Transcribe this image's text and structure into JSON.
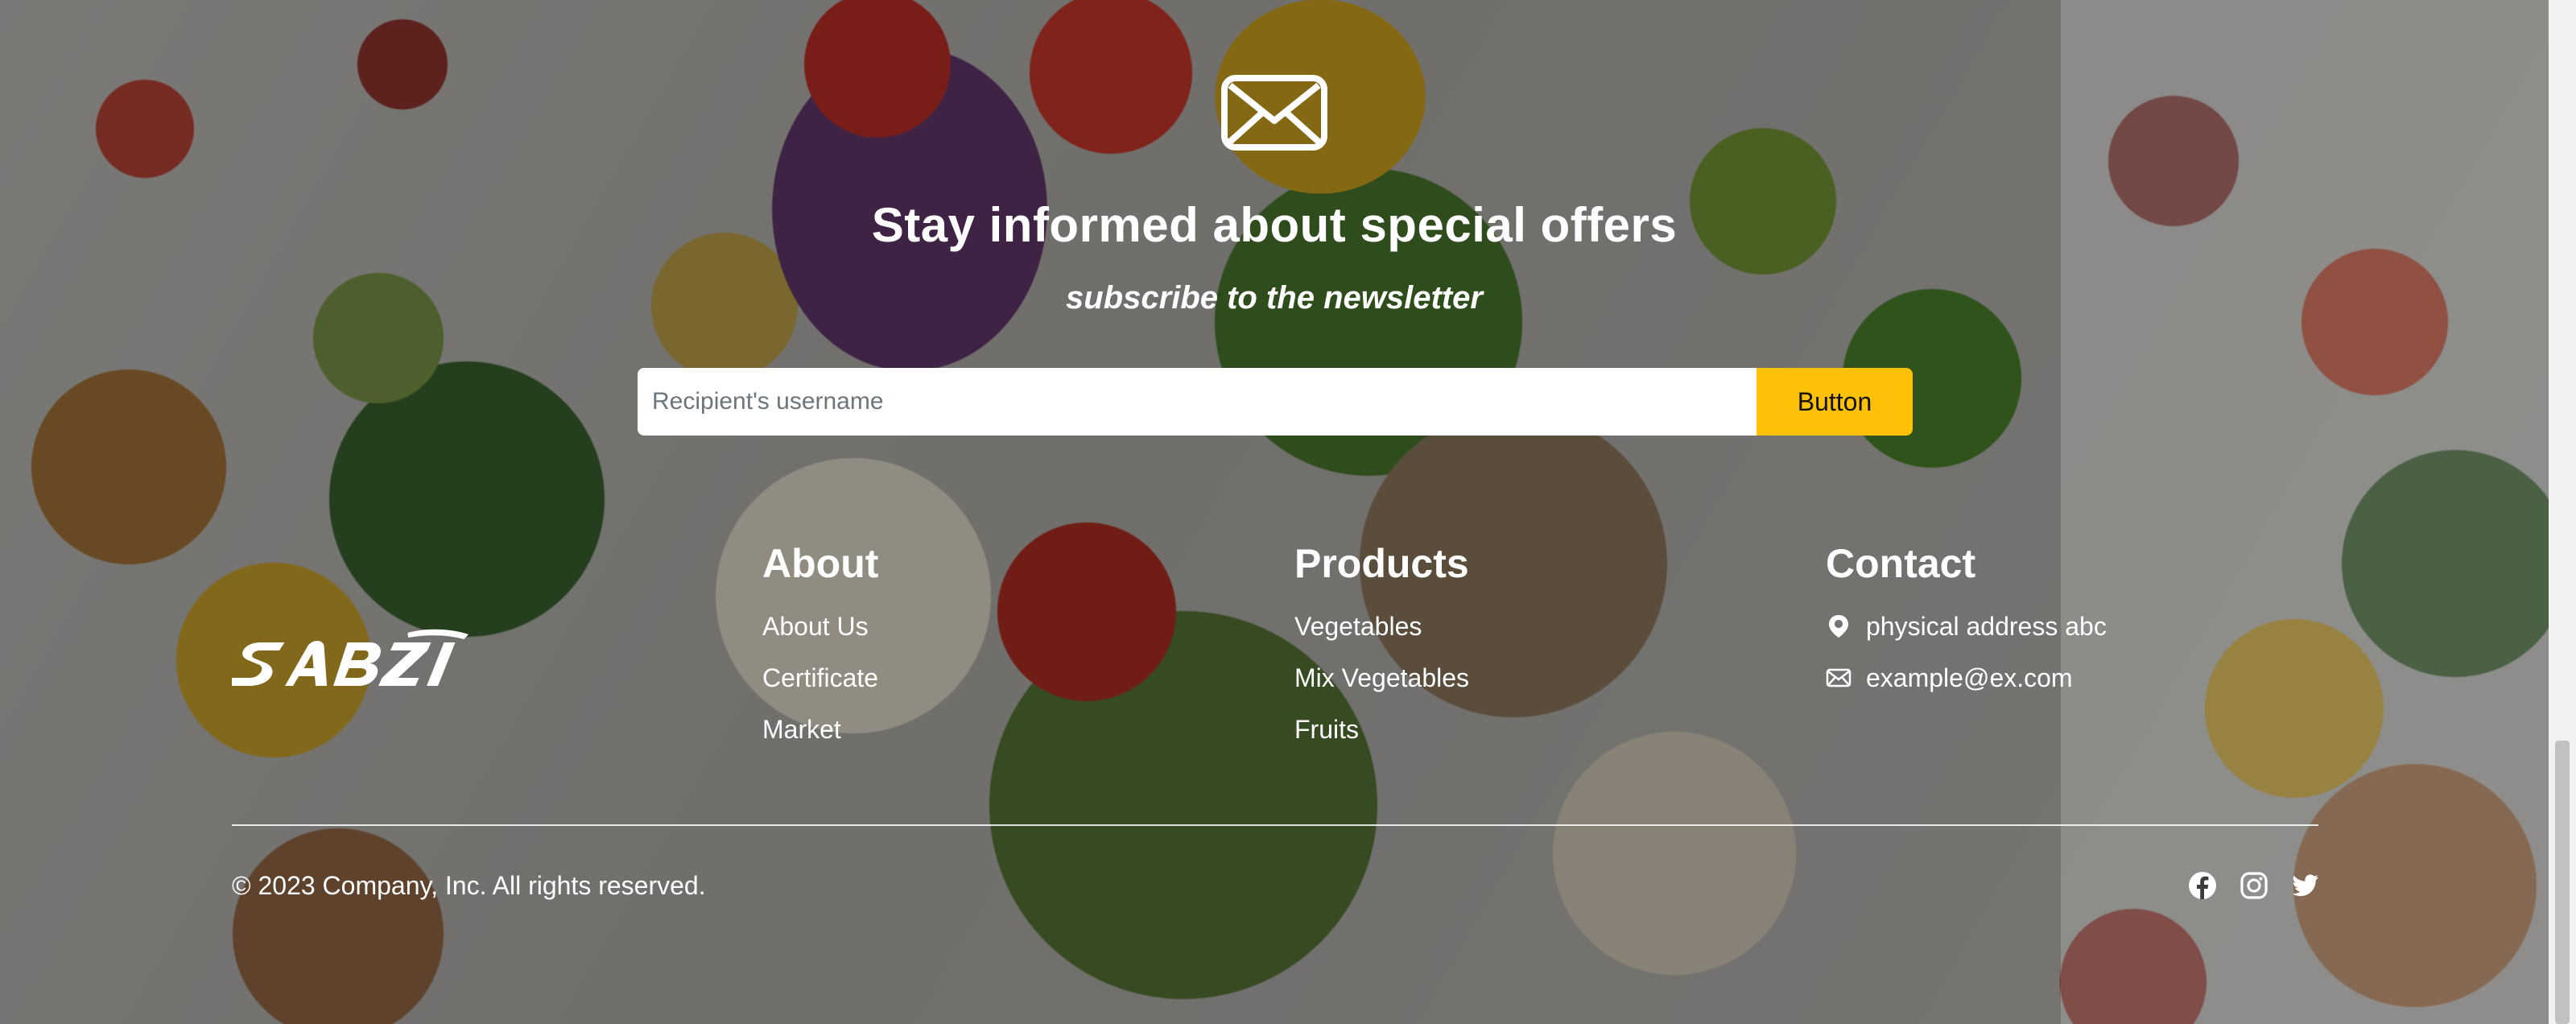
{
  "newsletter": {
    "title": "Stay informed about special offers",
    "subtitle": "subscribe to the newsletter",
    "input_placeholder": "Recipient's username",
    "button_label": "Button"
  },
  "brand": {
    "logo_text": "SABZI"
  },
  "footer": {
    "about": {
      "heading": "About",
      "links": [
        "About Us",
        "Certificate",
        "Market"
      ]
    },
    "products": {
      "heading": "Products",
      "links": [
        "Vegetables",
        "Mix Vegetables",
        "Fruits"
      ]
    },
    "contact": {
      "heading": "Contact",
      "address": "physical address abc",
      "email": "example@ex.com"
    },
    "copyright": "© 2023 Company, Inc. All rights reserved.",
    "social_icons": [
      "facebook-icon",
      "instagram-icon",
      "twitter-icon"
    ]
  },
  "colors": {
    "accent": "#ffc107",
    "text": "#ffffff",
    "overlay": "#141414"
  }
}
